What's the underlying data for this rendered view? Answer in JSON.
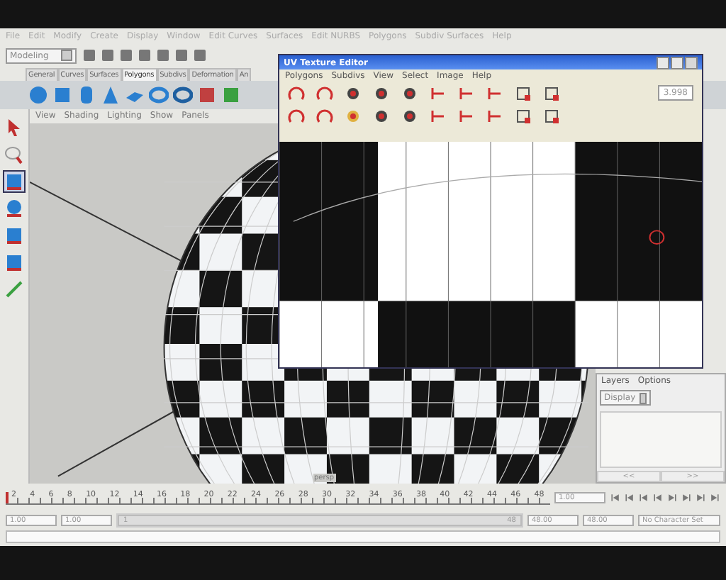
{
  "menu_bar": [
    "File",
    "Edit",
    "Modify",
    "Create",
    "Display",
    "Window",
    "Edit Curves",
    "Surfaces",
    "Edit NURBS",
    "Polygons",
    "Subdiv Surfaces",
    "Help"
  ],
  "toolbar": {
    "mode": "Modeling"
  },
  "shelf_tabs": [
    {
      "label": "General",
      "selected": false
    },
    {
      "label": "Curves",
      "selected": false
    },
    {
      "label": "Surfaces",
      "selected": false
    },
    {
      "label": "Polygons",
      "selected": true
    },
    {
      "label": "Subdivs",
      "selected": false
    },
    {
      "label": "Deformation",
      "selected": false
    },
    {
      "label": "An",
      "selected": false
    }
  ],
  "panel_menu": [
    "View",
    "Shading",
    "Lighting",
    "Show",
    "Panels"
  ],
  "viewport": {
    "camera_label": "persp"
  },
  "uv_editor": {
    "title": "UV Texture Editor",
    "menu": [
      "Polygons",
      "Subdivs",
      "View",
      "Select",
      "Image",
      "Help"
    ],
    "field_value": "3.998"
  },
  "layers": {
    "menu": [
      "Layers",
      "Options"
    ],
    "display": "Display",
    "nav": [
      "<<",
      ">>"
    ]
  },
  "timeline": {
    "ticks": [
      "2",
      "4",
      "6",
      "8",
      "10",
      "12",
      "14",
      "16",
      "18",
      "20",
      "22",
      "24",
      "26",
      "28",
      "30",
      "32",
      "34",
      "36",
      "38",
      "40",
      "42",
      "44",
      "46",
      "48"
    ],
    "current": "1.00",
    "level": 0
  },
  "range": {
    "start": "1.00",
    "inner_start": "1.00",
    "slider_start": "1",
    "slider_end": "48",
    "level": 1,
    "inner_end": "48.00",
    "end": "48.00",
    "character_set": "No Character Set"
  }
}
